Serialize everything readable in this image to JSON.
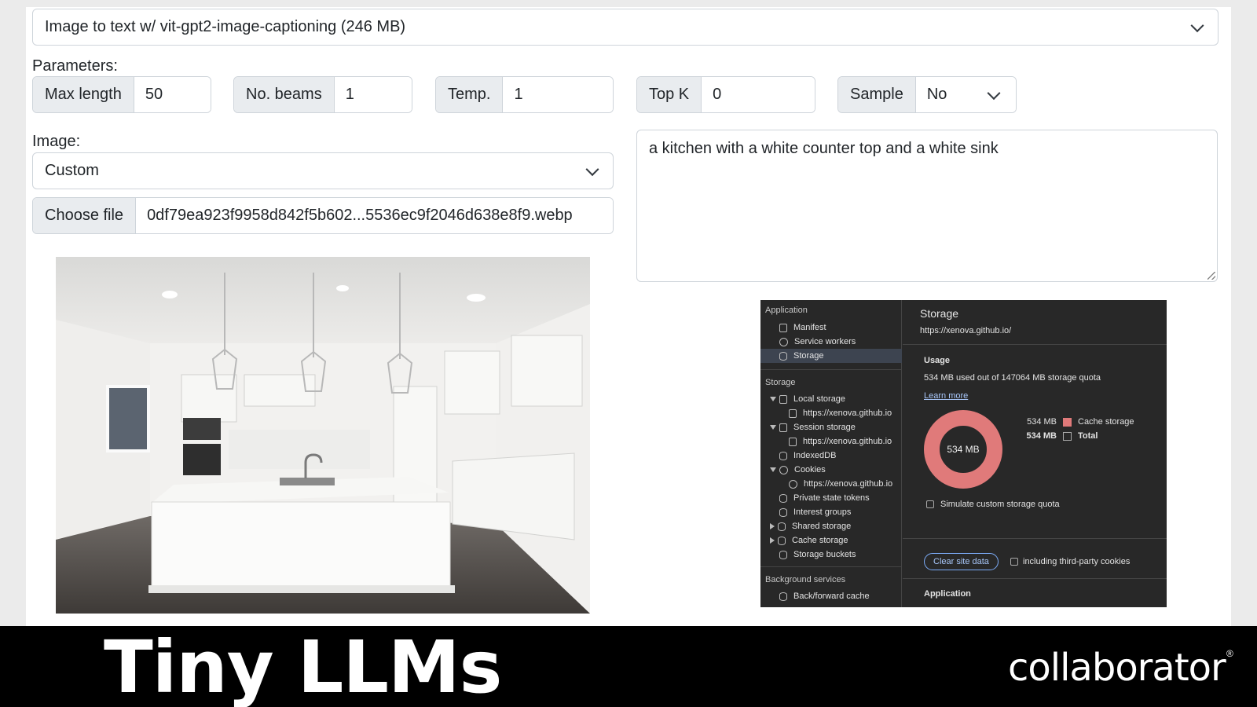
{
  "task_select": {
    "value": "Image to text w/ vit-gpt2-image-captioning (246 MB)"
  },
  "parameters": {
    "heading": "Parameters:",
    "max_length": {
      "label": "Max length",
      "value": "50"
    },
    "num_beams": {
      "label": "No. beams",
      "value": "1"
    },
    "temperature": {
      "label": "Temp.",
      "value": "1"
    },
    "top_k": {
      "label": "Top K",
      "value": "0"
    },
    "sample": {
      "label": "Sample",
      "value": "No"
    }
  },
  "image": {
    "heading": "Image:",
    "source_select": "Custom",
    "choose_file_label": "Choose file",
    "file_name": "0df79ea923f9958d842f5b602...5536ec9f2046d638e8f9.webp"
  },
  "output": {
    "text": "a kitchen with a white counter top and a white sink"
  },
  "devtools": {
    "sidebar": {
      "application_heading": "Application",
      "manifest": "Manifest",
      "service_workers": "Service workers",
      "storage": "Storage",
      "storage_heading": "Storage",
      "local_storage": "Local storage",
      "local_storage_origin": "https://xenova.github.io",
      "session_storage": "Session storage",
      "session_storage_origin": "https://xenova.github.io",
      "indexeddb": "IndexedDB",
      "cookies": "Cookies",
      "cookies_origin": "https://xenova.github.io",
      "private_state_tokens": "Private state tokens",
      "interest_groups": "Interest groups",
      "shared_storage": "Shared storage",
      "cache_storage": "Cache storage",
      "storage_buckets": "Storage buckets",
      "background_heading": "Background services",
      "bfcache": "Back/forward cache"
    },
    "main": {
      "title": "Storage",
      "origin": "https://xenova.github.io/",
      "usage_heading": "Usage",
      "usage_text": "534 MB used out of 147064 MB storage quota",
      "learn_more": "Learn more",
      "donut_label": "534 MB",
      "legend": [
        {
          "value": "534 MB",
          "label": "Cache storage",
          "color": "#e07a7a"
        },
        {
          "value": "534 MB",
          "label": "Total",
          "color": ""
        }
      ],
      "simulate_label": "Simulate custom storage quota",
      "clear_button": "Clear site data",
      "third_party_label": "including third-party cookies",
      "application_heading": "Application"
    }
  },
  "banner": {
    "title": "Tiny LLMs",
    "brand": "collaborator",
    "brand_mark": "®"
  },
  "colors": {
    "accent": "#e07a7a",
    "banner_bg": "#000000"
  }
}
